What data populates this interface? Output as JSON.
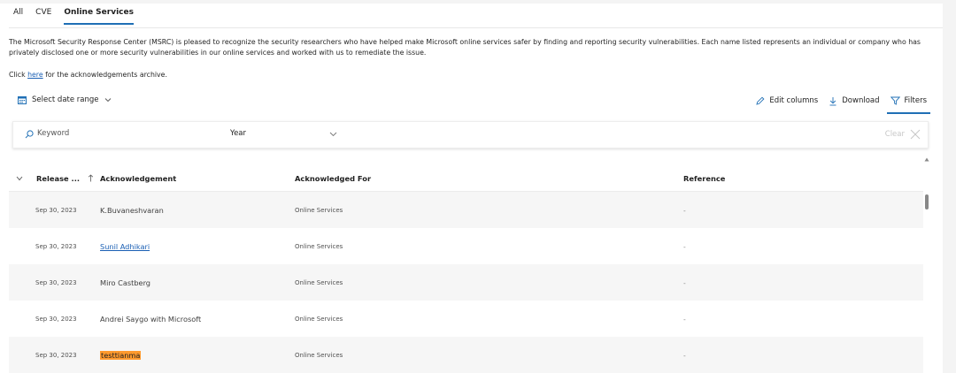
{
  "tabs": [
    {
      "label": "All"
    },
    {
      "label": "CVE"
    },
    {
      "label": "Online Services"
    }
  ],
  "intro": {
    "text": "The Microsoft Security Response Center (MSRC) is pleased to recognize the security researchers who have helped make Microsoft online services safer by finding and reporting security vulnerabilities. Each name listed represents an individual or company who has privately disclosed one or more security vulnerabilities in our online services and worked with us to remediate the issue."
  },
  "archive": {
    "prefix": "Click ",
    "link": "here",
    "suffix": " for the acknowledgements archive."
  },
  "toolbar": {
    "date_range_label": "Select date range",
    "edit_columns_label": "Edit columns",
    "download_label": "Download",
    "filters_label": "Filters"
  },
  "filterbar": {
    "keyword_placeholder": "Keyword",
    "year_label": "Year",
    "clear_label": "Clear"
  },
  "table": {
    "columns": [
      "Release ...",
      "Acknowledgement",
      "Acknowledged For",
      "Reference"
    ],
    "rows": [
      {
        "date": "Sep 30, 2023",
        "ack": "K.Buvaneshvaran",
        "for": "Online Services",
        "ref": "-"
      },
      {
        "date": "Sep 30, 2023",
        "ack": "Sunil Adhikari",
        "for": "Online Services",
        "ref": "-"
      },
      {
        "date": "Sep 30, 2023",
        "ack": "Miro Castberg",
        "for": "Online Services",
        "ref": "-"
      },
      {
        "date": "Sep 30, 2023",
        "ack": "Andrei Saygo with Microsoft",
        "for": "Online Services",
        "ref": "-"
      },
      {
        "date": "Sep 30, 2023",
        "ack": "testtianma",
        "for": "Online Services",
        "ref": "-"
      }
    ]
  },
  "colors": {
    "accent": "#1f6fb5",
    "link": "#1a5fb4",
    "highlight": "#ff9a2e",
    "row_alt": "#f6f6f6"
  },
  "icons": [
    "calendar-icon",
    "chevron-down-icon",
    "pencil-icon",
    "download-icon",
    "filter-icon",
    "search-icon",
    "close-icon",
    "sort-arrow-icon",
    "scroll-up-icon"
  ]
}
